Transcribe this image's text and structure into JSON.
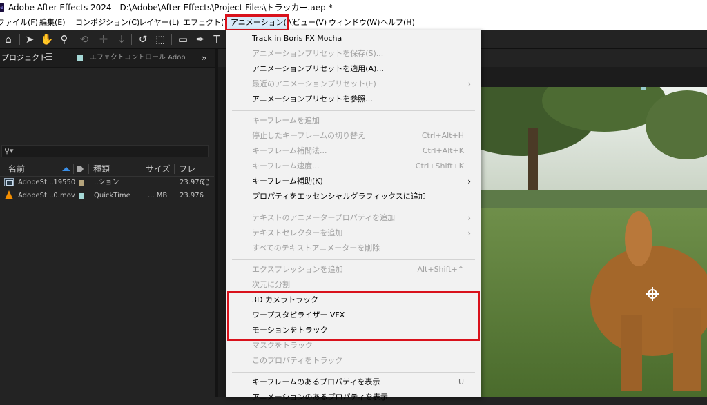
{
  "window": {
    "title": "Adobe After Effects 2024 - D:\\Adobe\\After Effects\\Project Files\\トラッカー.aep *",
    "app_icon": "Ae"
  },
  "menubar": {
    "items": [
      {
        "label": "ファイル(F)"
      },
      {
        "label": "編集(E)"
      },
      {
        "label": "コンポジション(C)"
      },
      {
        "label": "レイヤー(L)"
      },
      {
        "label": "エフェクト(T)"
      },
      {
        "label": "アニメーション(A)",
        "active": true
      },
      {
        "label": "ビュー(V)"
      },
      {
        "label": "ウィンドウ(W)"
      },
      {
        "label": "ヘルプ(H)"
      }
    ]
  },
  "toolbar": {
    "tools": [
      "home-icon",
      "selection-arrow-icon",
      "hand-icon",
      "zoom-icon",
      "orbit-icon",
      "pan-behind-icon",
      "dolly-icon",
      "rotate-icon",
      "region-icon",
      "rectangle-icon",
      "pen-icon",
      "type-icon"
    ]
  },
  "project_panel": {
    "tab_project": "プロジェクト",
    "tab_effects": "エフェクトコントロール AdobeSt",
    "more": "»",
    "columns": {
      "name": "名前",
      "type": "種類",
      "size": "サイズ",
      "frame": "フレ"
    },
    "rows": [
      {
        "name": "AdobeSt...19550",
        "type": "..ション",
        "size": "",
        "fps": "23.976",
        "swatch_color": "#b5a47c",
        "icon": "composition-icon"
      },
      {
        "name": "AdobeSt...0.mov",
        "type": "QuickTime",
        "size": "... MB",
        "fps": "23.976",
        "swatch_color": "#a5d8d6",
        "icon": "footage-cone-icon"
      }
    ]
  },
  "dropdown": {
    "items": [
      {
        "label": "Track in Boris FX Mocha",
        "enabled": true
      },
      {
        "label": "アニメーションプリセットを保存(S)...",
        "enabled": false
      },
      {
        "label": "アニメーションプリセットを適用(A)...",
        "enabled": true
      },
      {
        "label": "最近のアニメーションプリセット(E)",
        "enabled": false,
        "submenu": true
      },
      {
        "label": "アニメーションプリセットを参照...",
        "enabled": true
      },
      {
        "separator": true
      },
      {
        "label": "キーフレームを追加",
        "enabled": false
      },
      {
        "label": "停止したキーフレームの切り替え",
        "enabled": false,
        "shortcut": "Ctrl+Alt+H"
      },
      {
        "label": "キーフレーム補間法...",
        "enabled": false,
        "shortcut": "Ctrl+Alt+K"
      },
      {
        "label": "キーフレーム速度...",
        "enabled": false,
        "shortcut": "Ctrl+Shift+K"
      },
      {
        "label": "キーフレーム補助(K)",
        "enabled": true,
        "submenu": true
      },
      {
        "label": "プロパティをエッセンシャルグラフィックスに追加",
        "enabled": true
      },
      {
        "separator": true
      },
      {
        "label": "テキストのアニメータープロパティを追加",
        "enabled": false,
        "submenu": true
      },
      {
        "label": "テキストセレクターを追加",
        "enabled": false,
        "submenu": true
      },
      {
        "label": "すべてのテキストアニメーターを削除",
        "enabled": false
      },
      {
        "separator": true
      },
      {
        "label": "エクスプレッションを追加",
        "enabled": false,
        "shortcut": "Alt+Shift+^"
      },
      {
        "label": "次元に分割",
        "enabled": false
      },
      {
        "label": "3D カメラトラック",
        "enabled": true
      },
      {
        "label": "ワープスタビライザー VFX",
        "enabled": true
      },
      {
        "label": "モーションをトラック",
        "enabled": true
      },
      {
        "label": "マスクをトラック",
        "enabled": false
      },
      {
        "label": "このプロパティをトラック",
        "enabled": false
      },
      {
        "separator": true
      },
      {
        "label": "キーフレームのあるプロパティを表示",
        "enabled": true,
        "shortcut": "U"
      },
      {
        "label": "アニメーションのあるプロパティを表示",
        "enabled": true
      }
    ]
  },
  "colors": {
    "highlight_border": "#d9121c",
    "menu_active_bg": "#d9ebfa",
    "footage_swatch": "#a5d8d6",
    "comp_swatch": "#b5a47c"
  }
}
